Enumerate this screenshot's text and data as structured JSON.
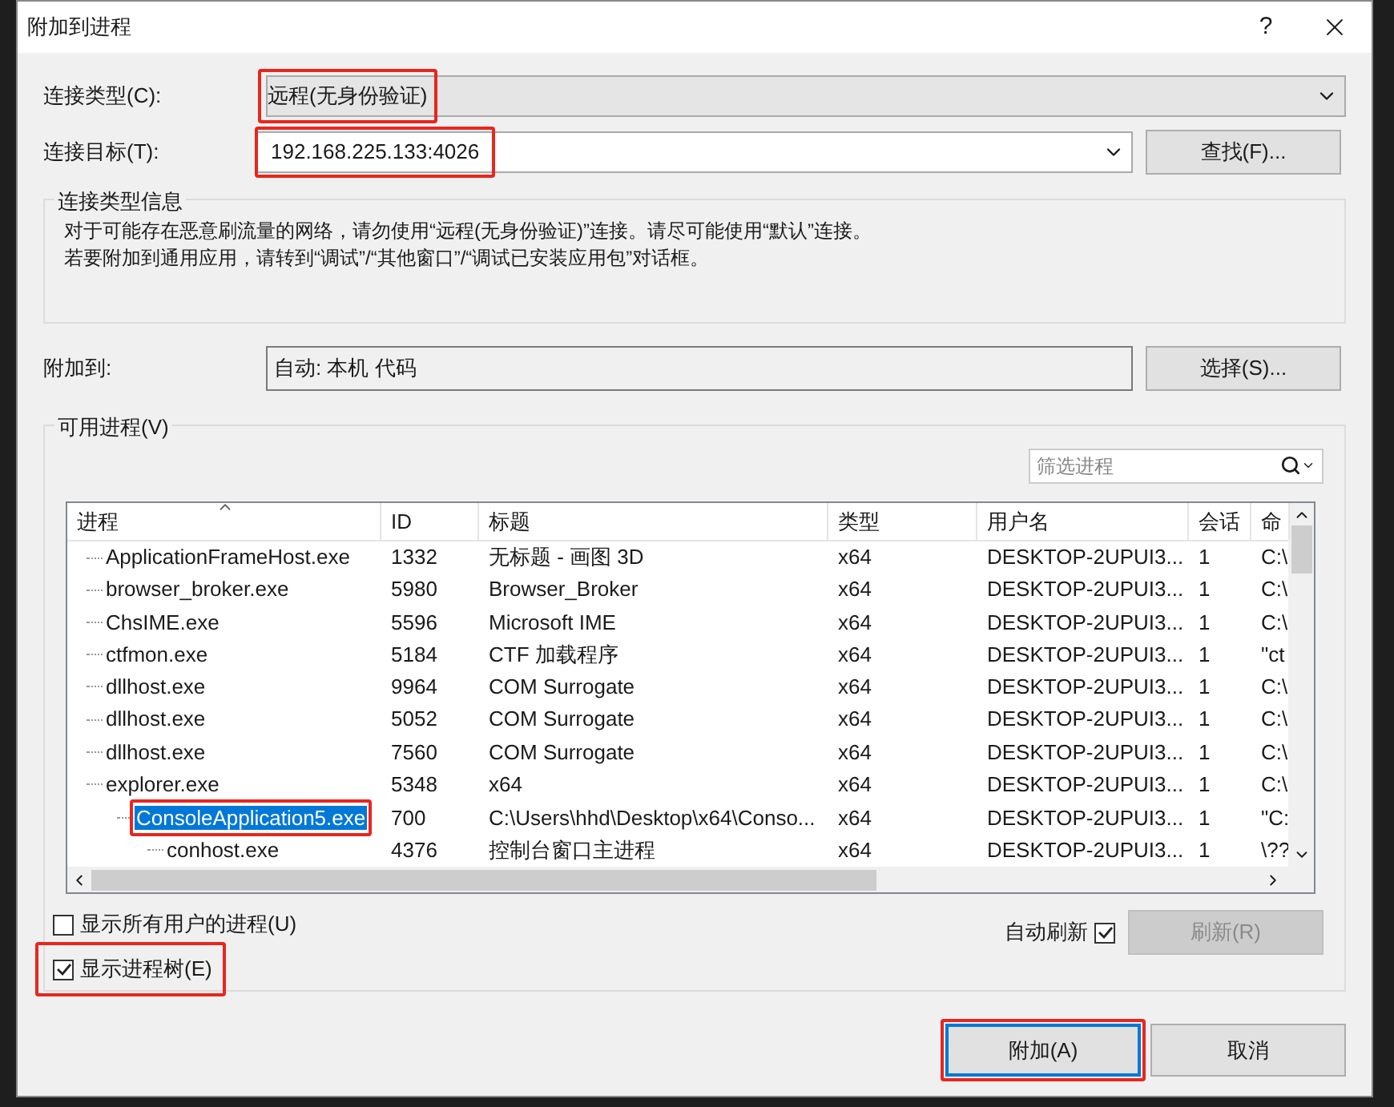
{
  "window": {
    "title": "附加到进程",
    "help": "?"
  },
  "connection_type": {
    "label": "连接类型(C):",
    "value": "远程(无身份验证)",
    "annotated": true
  },
  "connection_target": {
    "label": "连接目标(T):",
    "value": "192.168.225.133:4026",
    "annotated": true,
    "button": "查找(F)..."
  },
  "info": {
    "title": "连接类型信息",
    "lines": [
      "对于可能存在恶意刷流量的网络，请勿使用“远程(无身份验证)”连接。请尽可能使用“默认”连接。",
      "若要附加到通用应用，请转到“调试”/“其他窗口”/“调试已安装应用包”对话框。"
    ]
  },
  "attach_to": {
    "label": "附加到:",
    "value": "自动: 本机 代码",
    "button": "选择(S)..."
  },
  "available": {
    "title": "可用进程(V)",
    "filter": {
      "placeholder": "筛选进程"
    },
    "columns": [
      "进程",
      "ID",
      "标题",
      "类型",
      "用户名",
      "会话",
      "命"
    ],
    "rows": [
      {
        "name": "ApplicationFrameHost.exe",
        "id": "1332",
        "title": "无标题 - 画图 3D",
        "type": "x64",
        "user": "DESKTOP-2UPUI3...",
        "session": "1",
        "command": "C:\\",
        "selected": false,
        "annotated": false
      },
      {
        "name": "browser_broker.exe",
        "id": "5980",
        "title": "Browser_Broker",
        "type": "x64",
        "user": "DESKTOP-2UPUI3...",
        "session": "1",
        "command": "C:\\",
        "selected": false,
        "annotated": false
      },
      {
        "name": "ChsIME.exe",
        "id": "5596",
        "title": "Microsoft IME",
        "type": "x64",
        "user": "DESKTOP-2UPUI3...",
        "session": "1",
        "command": "C:\\",
        "selected": false,
        "annotated": false
      },
      {
        "name": "ctfmon.exe",
        "id": "5184",
        "title": "CTF 加载程序",
        "type": "x64",
        "user": "DESKTOP-2UPUI3...",
        "session": "1",
        "command": "\"ct",
        "selected": false,
        "annotated": false
      },
      {
        "name": "dllhost.exe",
        "id": "9964",
        "title": "COM Surrogate",
        "type": "x64",
        "user": "DESKTOP-2UPUI3...",
        "session": "1",
        "command": "C:\\",
        "selected": false,
        "annotated": false
      },
      {
        "name": "dllhost.exe",
        "id": "5052",
        "title": "COM Surrogate",
        "type": "x64",
        "user": "DESKTOP-2UPUI3...",
        "session": "1",
        "command": "C:\\",
        "selected": false,
        "annotated": false
      },
      {
        "name": "dllhost.exe",
        "id": "7560",
        "title": "COM Surrogate",
        "type": "x64",
        "user": "DESKTOP-2UPUI3...",
        "session": "1",
        "command": "C:\\",
        "selected": false,
        "annotated": false
      },
      {
        "name": "explorer.exe",
        "id": "5348",
        "title": "x64",
        "type": "x64",
        "user": "DESKTOP-2UPUI3...",
        "session": "1",
        "command": "C:\\",
        "selected": false,
        "annotated": false,
        "children": [
          {
            "name": "ConsoleApplication5.exe",
            "id": "700",
            "title": "C:\\Users\\hhd\\Desktop\\x64\\Conso...",
            "type": "x64",
            "user": "DESKTOP-2UPUI3...",
            "session": "1",
            "command": "\"C:",
            "selected": true,
            "annotated": true,
            "children": [
              {
                "name": "conhost.exe",
                "id": "4376",
                "title": "控制台窗口主进程",
                "type": "x64",
                "user": "DESKTOP-2UPUI3...",
                "session": "1",
                "command": "\\??",
                "selected": false,
                "annotated": false
              }
            ]
          }
        ]
      }
    ]
  },
  "options": [
    {
      "label": "显示所有用户的进程(U)",
      "checked": false,
      "annotated": false
    },
    {
      "label": "显示进程树(E)",
      "checked": true,
      "annotated": true
    }
  ],
  "auto_refresh": {
    "label": "自动刷新",
    "checked": true
  },
  "refresh_button": {
    "label": "刷新(R)",
    "disabled": true
  },
  "buttons": [
    {
      "label": "附加(A)",
      "focused": true,
      "annotated": true
    },
    {
      "label": "取消",
      "focused": false,
      "annotated": false
    }
  ]
}
